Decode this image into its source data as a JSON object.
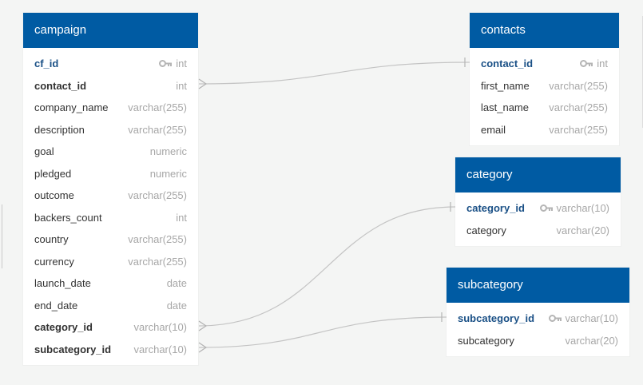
{
  "tables": {
    "campaign": {
      "title": "campaign",
      "columns": [
        {
          "name": "cf_id",
          "type": "int",
          "kind": "pk"
        },
        {
          "name": "contact_id",
          "type": "int",
          "kind": "fk"
        },
        {
          "name": "company_name",
          "type": "varchar(255)",
          "kind": ""
        },
        {
          "name": "description",
          "type": "varchar(255)",
          "kind": ""
        },
        {
          "name": "goal",
          "type": "numeric",
          "kind": ""
        },
        {
          "name": "pledged",
          "type": "numeric",
          "kind": ""
        },
        {
          "name": "outcome",
          "type": "varchar(255)",
          "kind": ""
        },
        {
          "name": "backers_count",
          "type": "int",
          "kind": ""
        },
        {
          "name": "country",
          "type": "varchar(255)",
          "kind": ""
        },
        {
          "name": "currency",
          "type": "varchar(255)",
          "kind": ""
        },
        {
          "name": "launch_date",
          "type": "date",
          "kind": ""
        },
        {
          "name": "end_date",
          "type": "date",
          "kind": ""
        },
        {
          "name": "category_id",
          "type": "varchar(10)",
          "kind": "fk"
        },
        {
          "name": "subcategory_id",
          "type": "varchar(10)",
          "kind": "fk"
        }
      ]
    },
    "contacts": {
      "title": "contacts",
      "columns": [
        {
          "name": "contact_id",
          "type": "int",
          "kind": "pk"
        },
        {
          "name": "first_name",
          "type": "varchar(255)",
          "kind": ""
        },
        {
          "name": "last_name",
          "type": "varchar(255)",
          "kind": ""
        },
        {
          "name": "email",
          "type": "varchar(255)",
          "kind": ""
        }
      ]
    },
    "category": {
      "title": "category",
      "columns": [
        {
          "name": "category_id",
          "type": "varchar(10)",
          "kind": "pk"
        },
        {
          "name": "category",
          "type": "varchar(20)",
          "kind": ""
        }
      ]
    },
    "subcategory": {
      "title": "subcategory",
      "columns": [
        {
          "name": "subcategory_id",
          "type": "varchar(10)",
          "kind": "pk"
        },
        {
          "name": "subcategory",
          "type": "varchar(20)",
          "kind": ""
        }
      ]
    }
  },
  "relationships": [
    {
      "from": "campaign.contact_id",
      "to": "contacts.contact_id",
      "from_end": "many",
      "to_end": "one"
    },
    {
      "from": "campaign.category_id",
      "to": "category.category_id",
      "from_end": "many",
      "to_end": "one"
    },
    {
      "from": "campaign.subcategory_id",
      "to": "subcategory.subcategory_id",
      "from_end": "many",
      "to_end": "one"
    }
  ],
  "icons": {
    "primary_key": "key-icon"
  },
  "colors": {
    "header": "#005ba3",
    "pk_text": "#1a5086",
    "line": "#c4c4c4",
    "type_text": "#a7a7a7",
    "background": "#f4f5f4"
  }
}
